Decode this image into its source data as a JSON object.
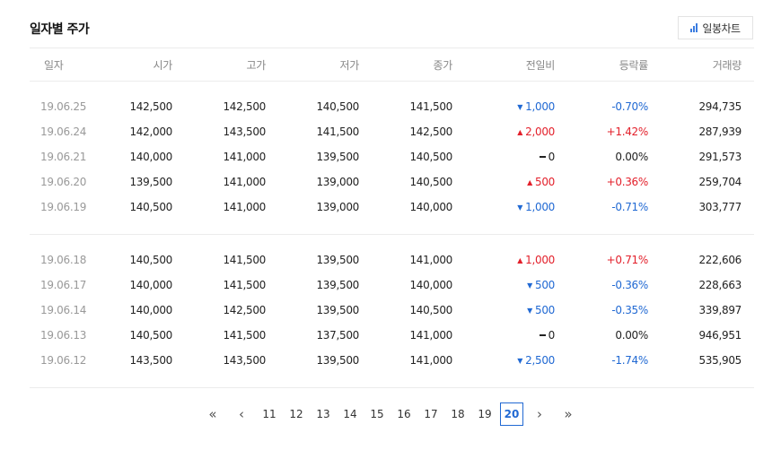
{
  "title": "일자별 주가",
  "chart_button": {
    "label": "일봉차트",
    "icon": "bar-chart-icon"
  },
  "columns": [
    "일자",
    "시가",
    "고가",
    "저가",
    "종가",
    "전일비",
    "등락률",
    "거래량"
  ],
  "groups": [
    [
      {
        "date": "19.06.25",
        "open": "142,500",
        "high": "142,500",
        "low": "140,500",
        "close": "141,500",
        "change": "1,000",
        "dir": "down",
        "rate": "-0.70%",
        "volume": "294,735"
      },
      {
        "date": "19.06.24",
        "open": "142,000",
        "high": "143,500",
        "low": "141,500",
        "close": "142,500",
        "change": "2,000",
        "dir": "up",
        "rate": "+1.42%",
        "volume": "287,939"
      },
      {
        "date": "19.06.21",
        "open": "140,000",
        "high": "141,000",
        "low": "139,500",
        "close": "140,500",
        "change": "0",
        "dir": "flat",
        "rate": "0.00%",
        "volume": "291,573"
      },
      {
        "date": "19.06.20",
        "open": "139,500",
        "high": "141,000",
        "low": "139,000",
        "close": "140,500",
        "change": "500",
        "dir": "up",
        "rate": "+0.36%",
        "volume": "259,704"
      },
      {
        "date": "19.06.19",
        "open": "140,500",
        "high": "141,000",
        "low": "139,000",
        "close": "140,000",
        "change": "1,000",
        "dir": "down",
        "rate": "-0.71%",
        "volume": "303,777"
      }
    ],
    [
      {
        "date": "19.06.18",
        "open": "140,500",
        "high": "141,500",
        "low": "139,500",
        "close": "141,000",
        "change": "1,000",
        "dir": "up",
        "rate": "+0.71%",
        "volume": "222,606"
      },
      {
        "date": "19.06.17",
        "open": "140,000",
        "high": "141,500",
        "low": "139,500",
        "close": "140,000",
        "change": "500",
        "dir": "down",
        "rate": "-0.36%",
        "volume": "228,663"
      },
      {
        "date": "19.06.14",
        "open": "140,000",
        "high": "142,500",
        "low": "139,500",
        "close": "140,500",
        "change": "500",
        "dir": "down",
        "rate": "-0.35%",
        "volume": "339,897"
      },
      {
        "date": "19.06.13",
        "open": "140,500",
        "high": "141,500",
        "low": "137,500",
        "close": "141,000",
        "change": "0",
        "dir": "flat",
        "rate": "0.00%",
        "volume": "946,951"
      },
      {
        "date": "19.06.12",
        "open": "143,500",
        "high": "143,500",
        "low": "139,500",
        "close": "141,000",
        "change": "2,500",
        "dir": "down",
        "rate": "-1.74%",
        "volume": "535,905"
      }
    ]
  ],
  "pagination": {
    "first_icon": "double-chevron-left-icon",
    "prev_icon": "chevron-left-icon",
    "next_icon": "chevron-right-icon",
    "last_icon": "double-chevron-right-icon",
    "pages": [
      "11",
      "12",
      "13",
      "14",
      "15",
      "16",
      "17",
      "18",
      "19",
      "20"
    ],
    "current": "20"
  },
  "colors": {
    "up": "#e3202b",
    "down": "#2169d3",
    "accent": "#2169d3"
  }
}
